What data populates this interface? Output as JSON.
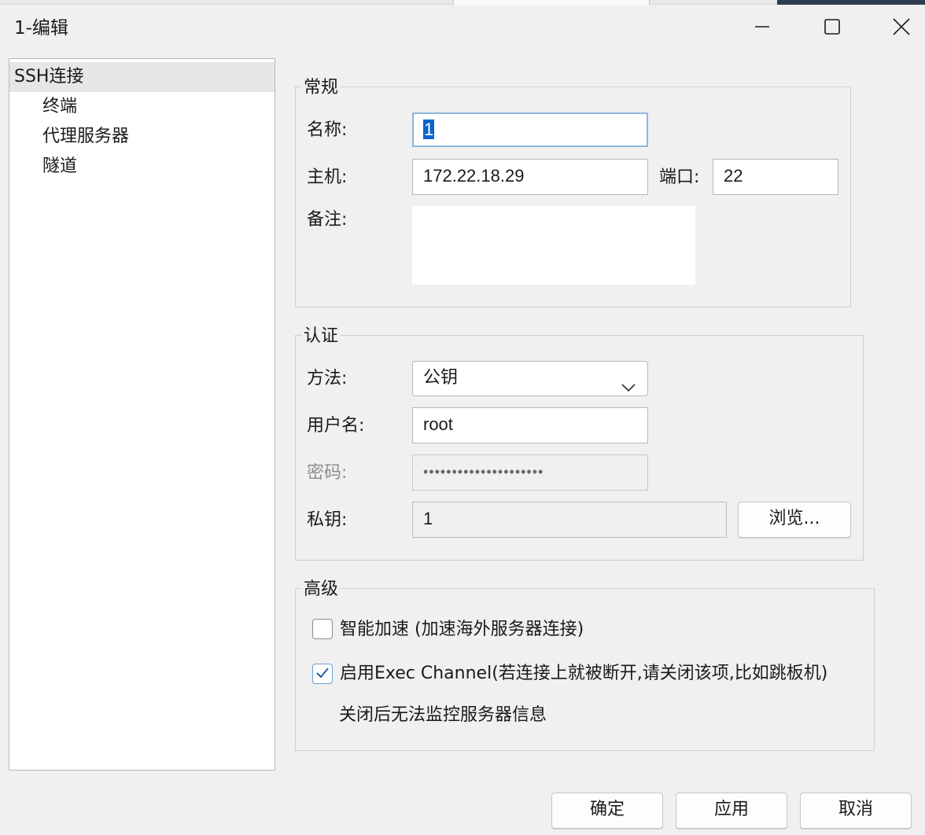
{
  "window": {
    "title": "1-编辑",
    "minimize_icon": "minimize-icon",
    "maximize_icon": "maximize-icon",
    "close_icon": "close-icon"
  },
  "tree": {
    "items": [
      {
        "label": "SSH连接",
        "selected": true
      },
      {
        "label": "终端",
        "selected": false
      },
      {
        "label": "代理服务器",
        "selected": false
      },
      {
        "label": "隧道",
        "selected": false
      }
    ]
  },
  "general": {
    "legend": "常规",
    "name_label": "名称:",
    "name_value": "1",
    "host_label": "主机:",
    "host_value": "172.22.18.29",
    "port_label": "端口:",
    "port_value": "22",
    "note_label": "备注:",
    "note_value": ""
  },
  "auth": {
    "legend": "认证",
    "method_label": "方法:",
    "method_value": "公钥",
    "username_label": "用户名:",
    "username_value": "root",
    "password_label": "密码:",
    "password_value": "•••••••••••••••••••••",
    "privatekey_label": "私钥:",
    "privatekey_value": "1",
    "browse_label": "浏览..."
  },
  "advanced": {
    "legend": "高级",
    "smart_accel_label": "智能加速 (加速海外服务器连接)",
    "smart_accel_checked": false,
    "exec_channel_label": "启用Exec Channel(若连接上就被断开,请关闭该项,比如跳板机)",
    "exec_channel_checked": true,
    "exec_channel_note": "关闭后无法监控服务器信息"
  },
  "footer": {
    "ok_label": "确定",
    "apply_label": "应用",
    "cancel_label": "取消"
  },
  "colors": {
    "accent": "#0a64d0",
    "focus_border": "#8fb6dd",
    "check": "#1d5fa8"
  }
}
